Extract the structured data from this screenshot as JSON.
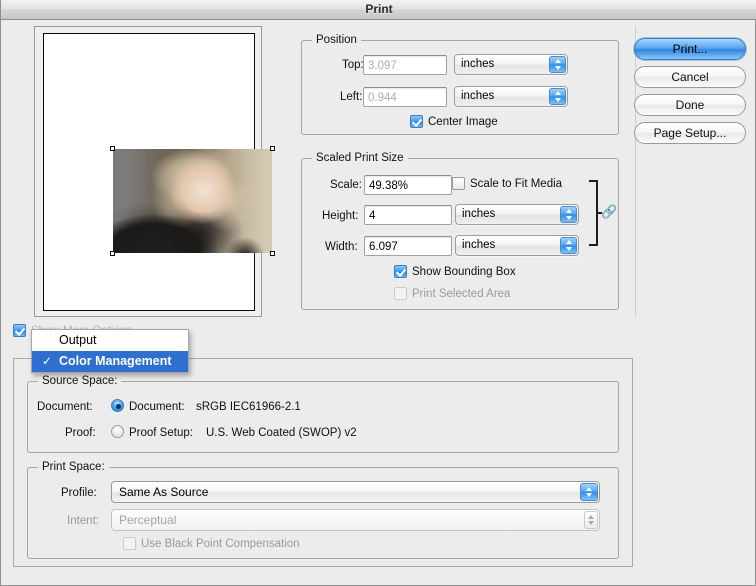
{
  "window": {
    "title": "Print"
  },
  "preview": {
    "name": "print-preview",
    "alt": "Photo of a person wearing a fur-trimmed parka hood"
  },
  "buttons": {
    "print": "Print...",
    "cancel": "Cancel",
    "done": "Done",
    "page_setup": "Page Setup..."
  },
  "position": {
    "legend": "Position",
    "top_label": "Top:",
    "top_value": "3.097",
    "top_unit": "inches",
    "left_label": "Left:",
    "left_value": "0.944",
    "left_unit": "inches",
    "center_image_label": "Center Image",
    "center_image_checked": true
  },
  "scaled_print_size": {
    "legend": "Scaled Print Size",
    "scale_label": "Scale:",
    "scale_value": "49.38%",
    "scale_to_fit_label": "Scale to Fit Media",
    "scale_to_fit_checked": false,
    "height_label": "Height:",
    "height_value": "4",
    "height_unit": "inches",
    "width_label": "Width:",
    "width_value": "6.097",
    "width_unit": "inches",
    "show_bounding_box_label": "Show Bounding Box",
    "show_bounding_box_checked": true,
    "print_selected_area_label": "Print Selected Area",
    "print_selected_area_checked": false,
    "link_icon": "chain-link-icon"
  },
  "show_more_options": {
    "label": "Show More Options",
    "checked": true
  },
  "menu": {
    "items": [
      {
        "label": "Output",
        "checked": false
      },
      {
        "label": "Color Management",
        "checked": true
      }
    ],
    "checkmark": "✓"
  },
  "source_space": {
    "legend": "Source Space:",
    "document_label": "Document:",
    "document_radio_label": "Document:",
    "document_profile": "sRGB IEC61966-2.1",
    "document_selected": true,
    "proof_label": "Proof:",
    "proof_radio_label": "Proof Setup:",
    "proof_profile": "U.S. Web Coated (SWOP) v2",
    "proof_selected": false
  },
  "print_space": {
    "legend": "Print Space:",
    "profile_label": "Profile:",
    "profile_value": "Same As Source",
    "intent_label": "Intent:",
    "intent_value": "Perceptual",
    "intent_disabled": true,
    "bpc_label": "Use Black Point Compensation",
    "bpc_checked": false,
    "bpc_disabled": true
  },
  "colors": {
    "accent_blue": "#2f6fd0",
    "control_blue": "#3f97ef",
    "window_bg": "#ececec",
    "group_border": "#a6a6a6"
  }
}
